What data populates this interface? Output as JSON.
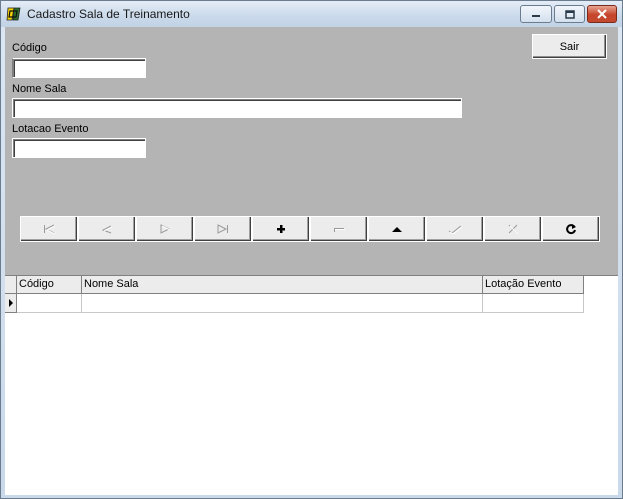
{
  "window": {
    "title": "Cadastro Sala de Treinamento"
  },
  "form": {
    "codigo_label": "Código",
    "codigo_value": "",
    "nome_sala_label": "Nome Sala",
    "nome_sala_value": "",
    "lotacao_label": "Lotacao Evento",
    "lotacao_value": "",
    "sair_label": "Sair"
  },
  "navigator": {
    "buttons": [
      {
        "name": "first",
        "icon": "first-record-icon",
        "enabled": false
      },
      {
        "name": "prior",
        "icon": "prior-record-icon",
        "enabled": false
      },
      {
        "name": "next",
        "icon": "next-record-icon",
        "enabled": false
      },
      {
        "name": "last",
        "icon": "last-record-icon",
        "enabled": false
      },
      {
        "name": "insert",
        "icon": "plus-icon",
        "enabled": true
      },
      {
        "name": "delete",
        "icon": "minus-icon",
        "enabled": false
      },
      {
        "name": "edit",
        "icon": "triangle-up-icon",
        "enabled": true
      },
      {
        "name": "post",
        "icon": "check-icon",
        "enabled": false
      },
      {
        "name": "cancel",
        "icon": "x-icon",
        "enabled": false
      },
      {
        "name": "refresh",
        "icon": "refresh-icon",
        "enabled": true
      }
    ]
  },
  "grid": {
    "columns": [
      "Código",
      "Nome Sala",
      "Lotação Evento"
    ],
    "rows": [
      [
        "",
        "",
        ""
      ]
    ]
  },
  "colors": {
    "client_bg": "#b4b4b4",
    "close_button": "#c6452b"
  }
}
